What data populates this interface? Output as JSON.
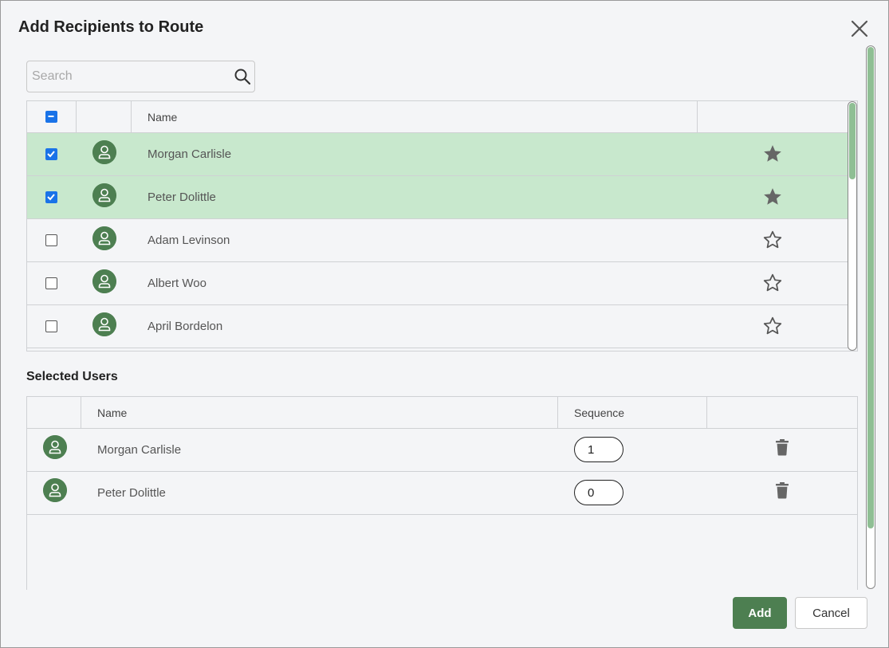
{
  "dialog": {
    "title": "Add Recipients to Route",
    "close_icon": "close-icon"
  },
  "search": {
    "placeholder": "Search",
    "value": "",
    "icon": "search-icon"
  },
  "recipients": {
    "columns": [
      "",
      "",
      "Name",
      ""
    ],
    "header_checkbox": "indeterminate",
    "rows": [
      {
        "name": "Morgan Carlisle",
        "checked": true,
        "favorite": true
      },
      {
        "name": "Peter Dolittle",
        "checked": true,
        "favorite": true
      },
      {
        "name": "Adam Levinson",
        "checked": false,
        "favorite": false
      },
      {
        "name": "Albert Woo",
        "checked": false,
        "favorite": false
      },
      {
        "name": "April Bordelon",
        "checked": false,
        "favorite": false
      }
    ]
  },
  "selected_users": {
    "title": "Selected Users",
    "columns": [
      "",
      "Name",
      "Sequence",
      ""
    ],
    "rows": [
      {
        "name": "Morgan Carlisle",
        "sequence": "1"
      },
      {
        "name": "Peter Dolittle",
        "sequence": "0"
      }
    ]
  },
  "footer": {
    "add_label": "Add",
    "cancel_label": "Cancel"
  },
  "colors": {
    "accent": "#4d7f51",
    "selected_row": "#c8e8cd",
    "checkbox": "#1a73e8",
    "scroll_thumb": "#8fbf94"
  }
}
